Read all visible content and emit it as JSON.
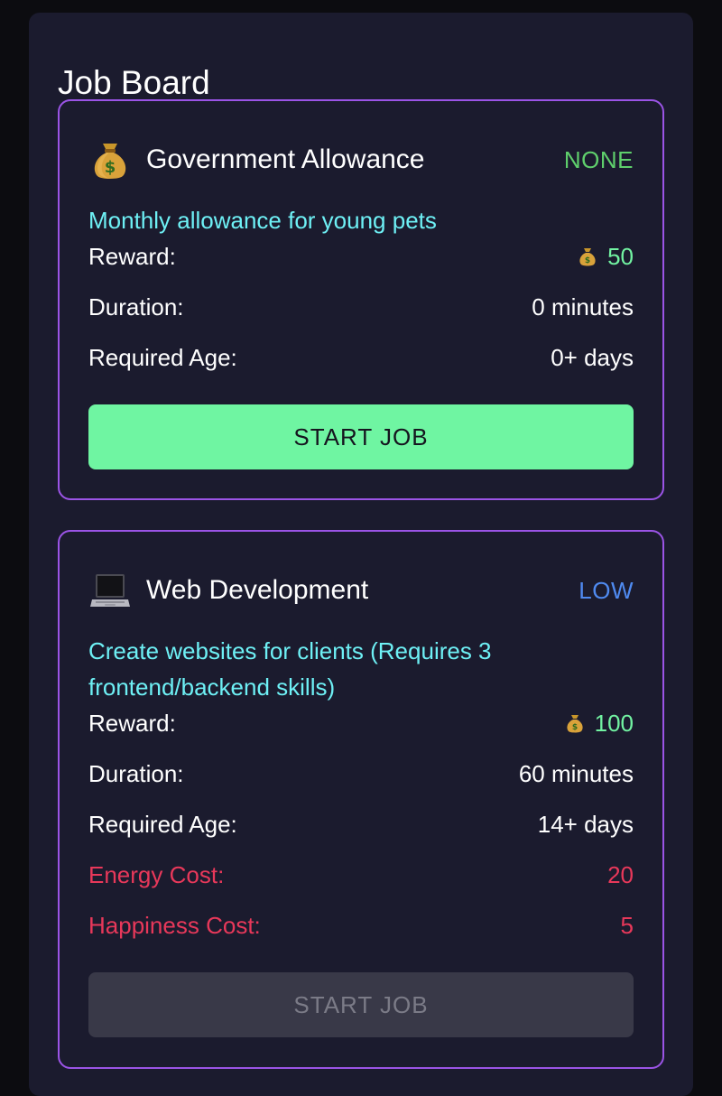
{
  "board": {
    "title": "Job Board"
  },
  "jobs": [
    {
      "icon": "money-bag-icon",
      "title": "Government Allowance",
      "level": "NONE",
      "level_color": "#5fcf6c",
      "description": "Monthly allowance for young pets",
      "reward_label": "Reward:",
      "reward_value": "50",
      "duration_label": "Duration:",
      "duration_value": "0 minutes",
      "age_label": "Required Age:",
      "age_value": "0+ days",
      "button_label": "START JOB",
      "button_enabled": true
    },
    {
      "icon": "laptop-icon",
      "title": "Web Development",
      "level": "LOW",
      "level_color": "#4f8af0",
      "description": "Create websites for clients (Requires 3 frontend/backend skills)",
      "reward_label": "Reward:",
      "reward_value": "100",
      "duration_label": "Duration:",
      "duration_value": "60 minutes",
      "age_label": "Required Age:",
      "age_value": "14+ days",
      "energy_label": "Energy Cost:",
      "energy_value": "20",
      "happiness_label": "Happiness Cost:",
      "happiness_value": "5",
      "button_label": "START JOB",
      "button_enabled": false
    }
  ]
}
